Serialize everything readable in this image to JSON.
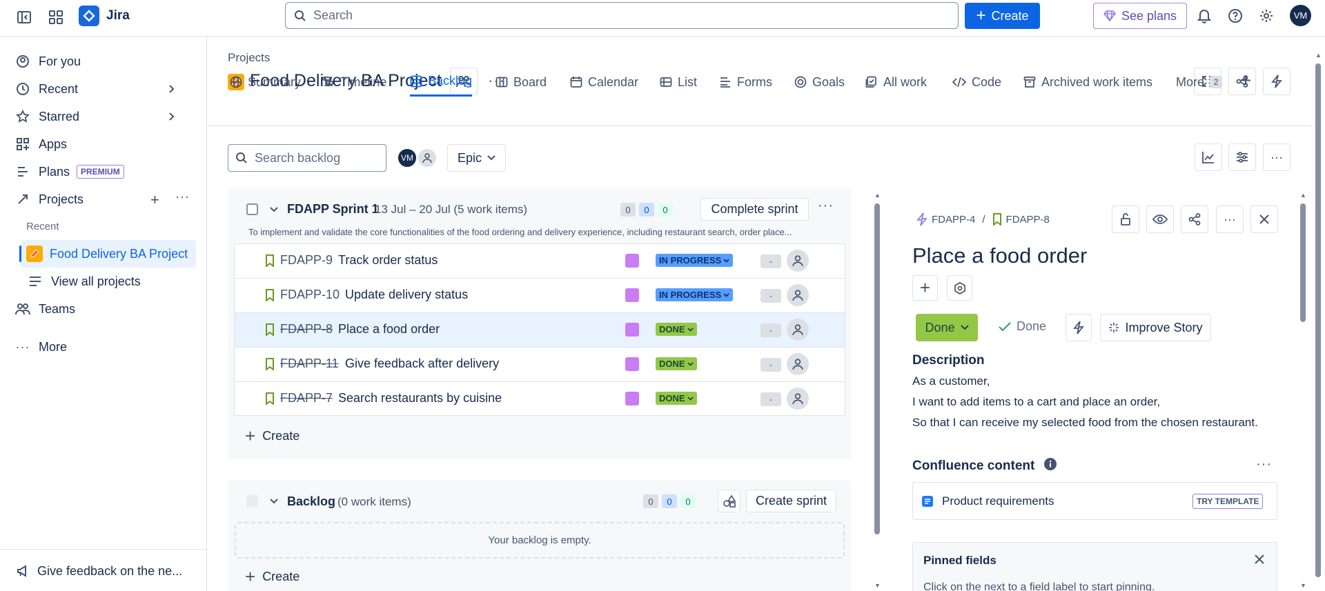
{
  "app": {
    "name": "Jira"
  },
  "topbar": {
    "search_placeholder": "Search",
    "create_label": "Create",
    "see_plans_label": "See plans",
    "avatar_initials": "VM"
  },
  "sidebar": {
    "for_you": "For you",
    "recent": "Recent",
    "starred": "Starred",
    "apps": "Apps",
    "plans": "Plans",
    "plans_badge": "PREMIUM",
    "projects": "Projects",
    "recent_header": "Recent",
    "active_project": "Food Delivery BA Project",
    "view_all": "View all projects",
    "teams": "Teams",
    "more": "More",
    "feedback": "Give feedback on the ne..."
  },
  "project": {
    "breadcrumb": "Projects",
    "title": "Food Delivery BA Project",
    "tabs": [
      {
        "label": "Summary"
      },
      {
        "label": "Timeline"
      },
      {
        "label": "Backlog"
      },
      {
        "label": "Board"
      },
      {
        "label": "Calendar"
      },
      {
        "label": "List"
      },
      {
        "label": "Forms"
      },
      {
        "label": "Goals"
      },
      {
        "label": "All work"
      },
      {
        "label": "Code"
      },
      {
        "label": "Archived work items"
      },
      {
        "label": "More"
      }
    ],
    "more_count": "2"
  },
  "toolbar": {
    "search_placeholder": "Search backlog",
    "avatar_initials": "VM",
    "epic_label": "Epic"
  },
  "sprint": {
    "name": "FDAPP Sprint 1",
    "dates": "13 Jul – 20 Jul (5 work items)",
    "count_todo": "0",
    "count_progress": "0",
    "count_done": "0",
    "complete_label": "Complete sprint",
    "goal": "To implement and validate the core functionalities of the food ordering and delivery experience, including restaurant search, order place...",
    "items": [
      {
        "key": "FDAPP-9",
        "summary": "Track order status",
        "status": "IN PROGRESS",
        "estimate": "-"
      },
      {
        "key": "FDAPP-10",
        "summary": "Update delivery status",
        "status": "IN PROGRESS",
        "estimate": "-"
      },
      {
        "key": "FDAPP-8",
        "summary": "Place a food order",
        "status": "DONE",
        "estimate": "-"
      },
      {
        "key": "FDAPP-11",
        "summary": "Give feedback after delivery",
        "status": "DONE",
        "estimate": "-"
      },
      {
        "key": "FDAPP-7",
        "summary": "Search restaurants by cuisine",
        "status": "DONE",
        "estimate": "-"
      }
    ],
    "create_label": "Create"
  },
  "backlog": {
    "name": "Backlog",
    "count": "(0 work items)",
    "count_todo": "0",
    "count_progress": "0",
    "count_done": "0",
    "create_sprint_label": "Create sprint",
    "empty_text": "Your backlog is empty.",
    "create_label": "Create"
  },
  "detail": {
    "parent_key": "FDAPP-4",
    "key": "FDAPP-8",
    "title": "Place a food order",
    "status_label": "Done",
    "resolution": "Done",
    "improve_label": "Improve Story",
    "description_heading": "Description",
    "description_lines": [
      "As a customer,",
      "I want to add items to a cart and place an order,",
      "So that I can receive my selected food from the chosen restaurant."
    ],
    "confluence_heading": "Confluence content",
    "confluence_item": "Product requirements",
    "try_template": "TRY TEMPLATE",
    "pinned_heading": "Pinned fields",
    "pinned_hint": "Click on the  next to a field label to start pinning."
  },
  "colors": {
    "brand": "#0c66e4",
    "done_green": "#94c748",
    "in_progress_blue": "#579dff",
    "epic_purple": "#c97cf4"
  }
}
